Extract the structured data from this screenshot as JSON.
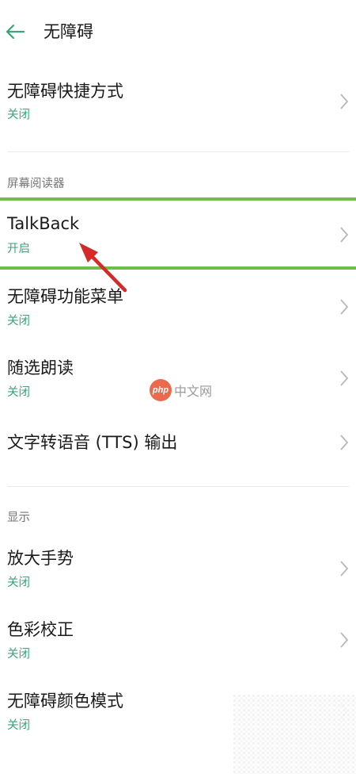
{
  "header": {
    "title": "无障碍"
  },
  "sections": {
    "screen_reader_label": "屏幕阅读器",
    "display_label": "显示"
  },
  "items": [
    {
      "title": "无障碍快捷方式",
      "status": "关闭"
    },
    {
      "title": "TalkBack",
      "status": "开启"
    },
    {
      "title": "无障碍功能菜单",
      "status": "关闭"
    },
    {
      "title": "随选朗读",
      "status": "关闭"
    },
    {
      "title": "文字转语音 (TTS) 输出"
    },
    {
      "title": "放大手势",
      "status": "关闭"
    },
    {
      "title": "色彩校正",
      "status": "关闭"
    },
    {
      "title": "无障碍颜色模式",
      "status": "关闭"
    }
  ],
  "watermark": {
    "logo_text": "php",
    "site_text": "中文网"
  },
  "colors": {
    "status_green": "#3aa57a",
    "highlight_green": "#6cc04a",
    "arrow_red": "#d42a2a",
    "back_teal": "#3aa57a"
  }
}
